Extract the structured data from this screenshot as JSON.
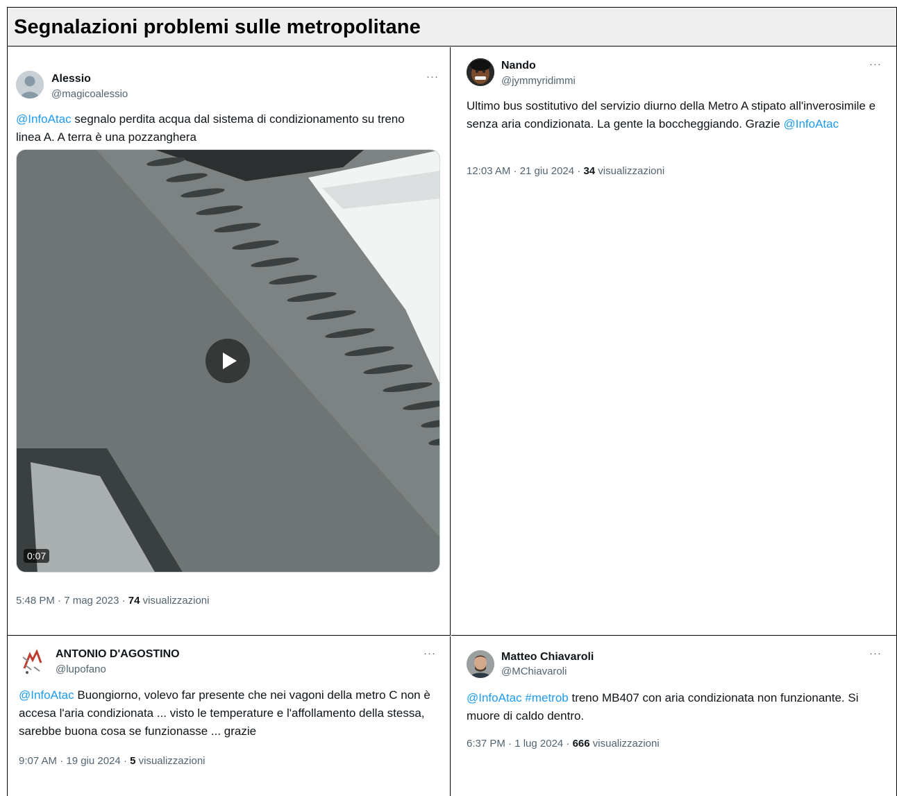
{
  "page": {
    "title": "Segnalazioni problemi sulle metropolitane"
  },
  "tweets": [
    {
      "name": "Alessio",
      "handle": "@magicoalessio",
      "more": "···",
      "text": [
        {
          "t": "@InfoAtac",
          "link": true
        },
        {
          "t": " segnalo perdita acqua dal sistema di condizionamento su treno linea A. A terra è una pozzanghera",
          "link": false
        }
      ],
      "video_duration": "0:07",
      "time": "5:48 PM · 7 mag 2023 · ",
      "views": "74",
      "views_label": " visualizzazioni"
    },
    {
      "name": "Nando",
      "handle": "@jymmyridimmi",
      "more": "···",
      "text": [
        {
          "t": "Ultimo bus sostitutivo del servizio diurno della Metro A stipato all'inverosimile e senza aria condizionata. La gente la boccheggiando. Grazie ",
          "link": false
        },
        {
          "t": "@InfoAtac",
          "link": true
        }
      ],
      "time": "12:03 AM · 21 giu 2024 · ",
      "views": "34",
      "views_label": " visualizzazioni"
    },
    {
      "name": "ANTONIO D'AGOSTINO",
      "handle": "@lupofano",
      "more": "···",
      "text": [
        {
          "t": "@InfoAtac",
          "link": true
        },
        {
          "t": " Buongiorno, volevo far presente che nei vagoni della metro C non è accesa l'aria condizionata ... visto le temperature e l'affollamento della stessa, sarebbe buona cosa se funzionasse ... grazie",
          "link": false
        }
      ],
      "time": "9:07 AM · 19 giu 2024 · ",
      "views": "5",
      "views_label": " visualizzazioni"
    },
    {
      "name": "Matteo Chiavaroli",
      "handle": "@MChiavaroli",
      "more": "···",
      "text": [
        {
          "t": "@InfoAtac",
          "link": true
        },
        {
          "t": " ",
          "link": false
        },
        {
          "t": "#metrob",
          "link": true
        },
        {
          "t": " treno MB407 con aria condizionata non funzionante. Si muore di caldo dentro.",
          "link": false
        }
      ],
      "time": "6:37 PM · 1 lug 2024 · ",
      "views": "666",
      "views_label": " visualizzazioni"
    }
  ]
}
